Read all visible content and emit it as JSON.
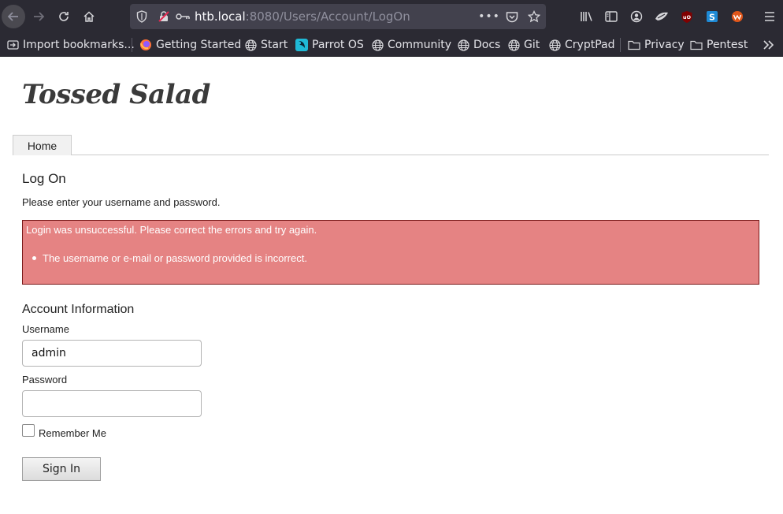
{
  "browser": {
    "url_host": "htb.local",
    "url_path": ":8080/Users/Account/LogOn",
    "icons": [
      "back-icon",
      "forward-icon",
      "reload-icon",
      "home-icon",
      "shield-icon",
      "insecure-lock-icon",
      "key-icon",
      "more-icon",
      "pocket-icon",
      "bookmark-star-icon",
      "library-icon",
      "sidebar-icon",
      "account-icon",
      "extension-foxyproxy-icon",
      "ublock-icon",
      "extension-s-icon",
      "extension-wappalyzer-icon",
      "menu-icon"
    ]
  },
  "bookmarks": [
    {
      "label": "Import bookmarks...",
      "icon": "import-icon"
    },
    {
      "label": "Getting Started",
      "icon": "firefox-icon"
    },
    {
      "label": "Start",
      "icon": "globe-icon"
    },
    {
      "label": "Parrot OS",
      "icon": "parrot-icon"
    },
    {
      "label": "Community",
      "icon": "globe-icon"
    },
    {
      "label": "Docs",
      "icon": "globe-icon"
    },
    {
      "label": "Git",
      "icon": "globe-icon"
    },
    {
      "label": "CryptPad",
      "icon": "globe-icon"
    },
    {
      "label": "Privacy",
      "icon": "folder-icon"
    },
    {
      "label": "Pentest",
      "icon": "folder-icon"
    }
  ],
  "page": {
    "site_title": "Tossed Salad",
    "tab_home": "Home",
    "heading": "Log On",
    "intro": "Please enter your username and password.",
    "error_summary": "Login was unsuccessful. Please correct the errors and try again.",
    "error_items": [
      "The username or e-mail or password provided is incorrect."
    ],
    "section_title": "Account Information",
    "username_label": "Username",
    "username_value": "admin",
    "password_label": "Password",
    "password_value": "",
    "remember_label": "Remember Me",
    "signin_label": "Sign In"
  },
  "colors": {
    "error_bg": "#e58383",
    "error_border": "#7a1a1a",
    "chrome_bg": "#2b2a33"
  }
}
